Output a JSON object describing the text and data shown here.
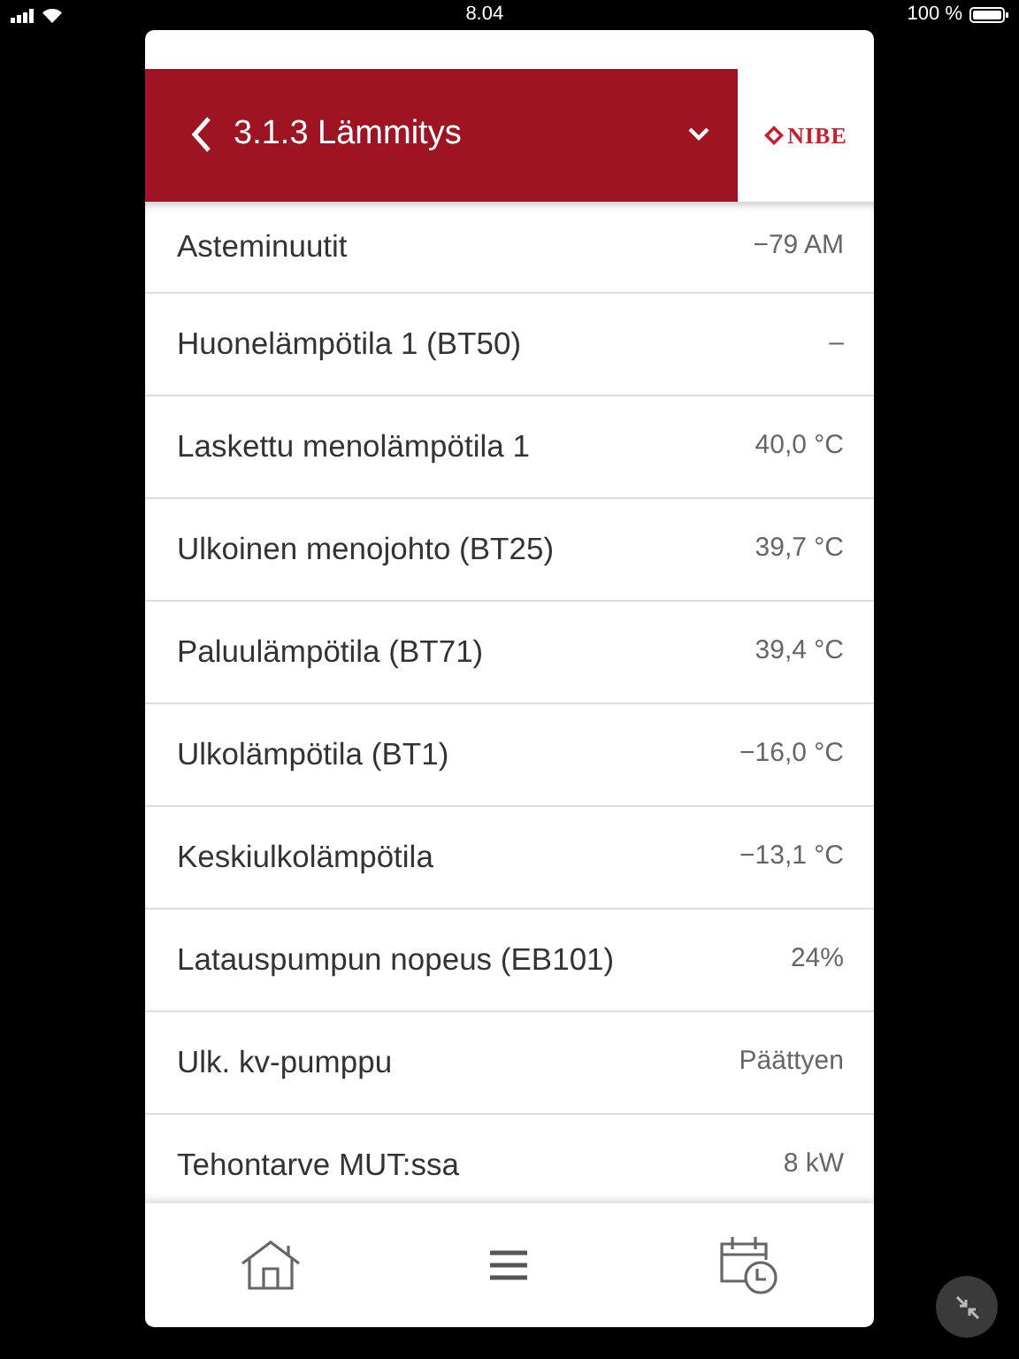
{
  "status_bar": {
    "time": "8.04",
    "battery": "100 %"
  },
  "header": {
    "title": "3.1.3 Lämmitys",
    "logo": "NIBE"
  },
  "rows": [
    {
      "label": "Asteminuutit",
      "value": "−79 AM"
    },
    {
      "label": "Huonelämpötila 1 (BT50)",
      "value": "–"
    },
    {
      "label": "Laskettu menolämpötila 1",
      "value": "40,0 °C"
    },
    {
      "label": "Ulkoinen menojohto (BT25)",
      "value": "39,7 °C"
    },
    {
      "label": "Paluulämpötila (BT71)",
      "value": "39,4 °C"
    },
    {
      "label": "Ulkolämpötila (BT1)",
      "value": "−16,0 °C"
    },
    {
      "label": "Keskiulkolämpötila",
      "value": "−13,1 °C"
    },
    {
      "label": "Latauspumpun nopeus (EB101)",
      "value": "24%"
    },
    {
      "label": "Ulk. kv-pumppu",
      "value": "Päättyen"
    },
    {
      "label": "Tehontarve MUT:ssa",
      "value": "8 kW"
    }
  ]
}
